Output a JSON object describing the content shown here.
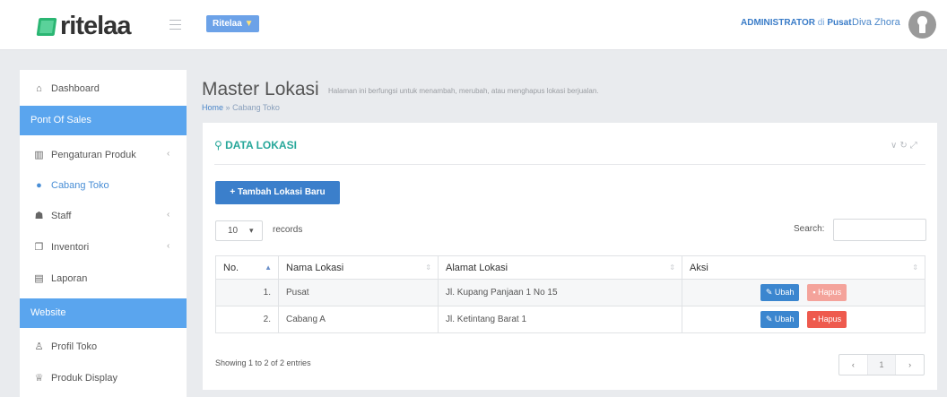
{
  "header": {
    "logo_text": "ritelaa",
    "brand_pill": "Ritelaa",
    "admin_role": "ADMINISTRATOR",
    "admin_at": "di",
    "admin_location": "Pusat",
    "user_name": "Diva Zhora"
  },
  "sidebar": {
    "items": [
      {
        "label": "Dashboard",
        "icon": "home-icon"
      },
      {
        "section": "Pont Of Sales"
      },
      {
        "label": "Pengaturan Produk",
        "icon": "boxes-icon",
        "chevron": "<"
      },
      {
        "label": "Cabang Toko",
        "icon": "map-marker-icon",
        "active": true
      },
      {
        "label": "Staff",
        "icon": "users-icon",
        "chevron": "<"
      },
      {
        "label": "Inventori",
        "icon": "copy-icon",
        "chevron": "<"
      },
      {
        "label": "Laporan",
        "icon": "document-icon"
      },
      {
        "section": "Website"
      },
      {
        "label": "Profil Toko",
        "icon": "user-icon"
      },
      {
        "label": "Produk Display",
        "icon": "trophy-icon"
      }
    ],
    "pos_header": "Pont Of Sales",
    "website_header": "Website",
    "labels": {
      "dashboard": "Dashboard",
      "pengaturan": "Pengaturan Produk",
      "cabang": "Cabang Toko",
      "staff": "Staff",
      "inventori": "Inventori",
      "laporan": "Laporan",
      "profil": "Profil Toko",
      "produk_display": "Produk Display"
    }
  },
  "page": {
    "title": "Master Lokasi",
    "subtitle": "Halaman ini berfungsi untuk menambah, merubah, atau menghapus lokasi berjualan.",
    "breadcrumb_home": "Home",
    "breadcrumb_sep": "»",
    "breadcrumb_current": "Cabang Toko"
  },
  "panel": {
    "title": "DATA LOKASI",
    "add_button": "Tambah Lokasi Baru",
    "records_value": "10",
    "records_label": "records",
    "search_label": "Search:",
    "search_value": "",
    "columns": [
      "No.",
      "Nama Lokasi",
      "Alamat Lokasi",
      "Aksi"
    ],
    "rows": [
      {
        "no": "1.",
        "nama": "Pusat",
        "alamat": "Jl. Kupang Panjaan 1 No 15",
        "edit": "Ubah",
        "delete": "Hapus"
      },
      {
        "no": "2.",
        "nama": "Cabang A",
        "alamat": "Jl. Ketintang Barat 1",
        "edit": "Ubah",
        "delete": "Hapus"
      }
    ],
    "info": "Showing 1 to 2 of 2 entries",
    "pager": {
      "prev": "‹",
      "current": "1",
      "next": "›"
    }
  },
  "colors": {
    "accent_blue": "#5aa5ee",
    "button_blue": "#3b7fcb",
    "teal_title": "#27a79a",
    "danger": "#ee5a4e"
  }
}
